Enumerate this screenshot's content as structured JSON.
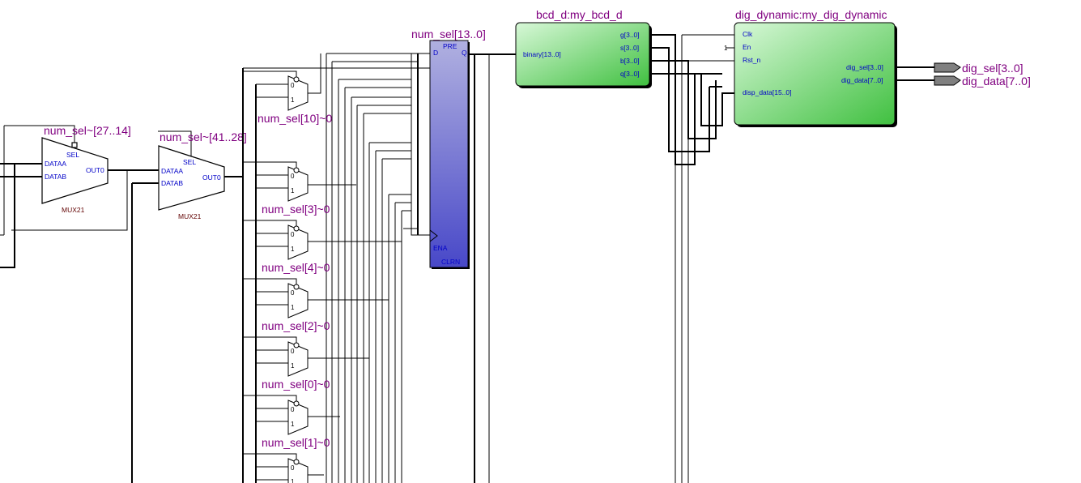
{
  "diagram": {
    "mux_top_a": {
      "name": "num_sel~[27..14]",
      "type": "MUX21",
      "ports": {
        "sel": "SEL",
        "dataa": "DATAA",
        "datab": "DATAB",
        "out": "OUT0"
      }
    },
    "mux_top_b": {
      "name": "num_sel~[41..28]",
      "type": "MUX21",
      "ports": {
        "sel": "SEL",
        "dataa": "DATAA",
        "datab": "DATAB",
        "out": "OUT0"
      }
    },
    "small_muxes": [
      {
        "label": "",
        "in0": "0",
        "in1": "1"
      },
      {
        "label": "num_sel[10]~0",
        "in0": "0",
        "in1": "1"
      },
      {
        "label": "num_sel[3]~0",
        "in0": "0",
        "in1": "1"
      },
      {
        "label": "num_sel[4]~0",
        "in0": "0",
        "in1": "1"
      },
      {
        "label": "num_sel[2]~0",
        "in0": "0",
        "in1": "1"
      },
      {
        "label": "num_sel[0]~0",
        "in0": "0",
        "in1": "1"
      },
      {
        "label": "num_sel[1]~0",
        "in0": "0",
        "in1": "1"
      }
    ],
    "register": {
      "name": "num_sel[13..0]",
      "d": "D",
      "pre": "PRE",
      "q": "Q",
      "ena": "ENA",
      "clrn": "CLRN"
    },
    "bcd": {
      "name": "bcd_d:my_bcd_d",
      "in": "binary[13..0]",
      "outs": [
        "g[3..0]",
        "s[3..0]",
        "b[3..0]",
        "q[3..0]"
      ]
    },
    "dig": {
      "name": "dig_dynamic:my_dig_dynamic",
      "ins": [
        "Clk",
        "En",
        "Rst_n",
        "disp_data[15..0]"
      ],
      "outs": [
        "dig_sel[3..0]",
        "dig_data[7..0]"
      ],
      "en_const": "1"
    },
    "output_pins": [
      "dig_sel[3..0]",
      "dig_data[7..0]"
    ],
    "colors": {
      "wire": "#000000",
      "label": "#800080",
      "port": "#0000c8",
      "register": "#5050c8",
      "module": "#50c850"
    }
  }
}
